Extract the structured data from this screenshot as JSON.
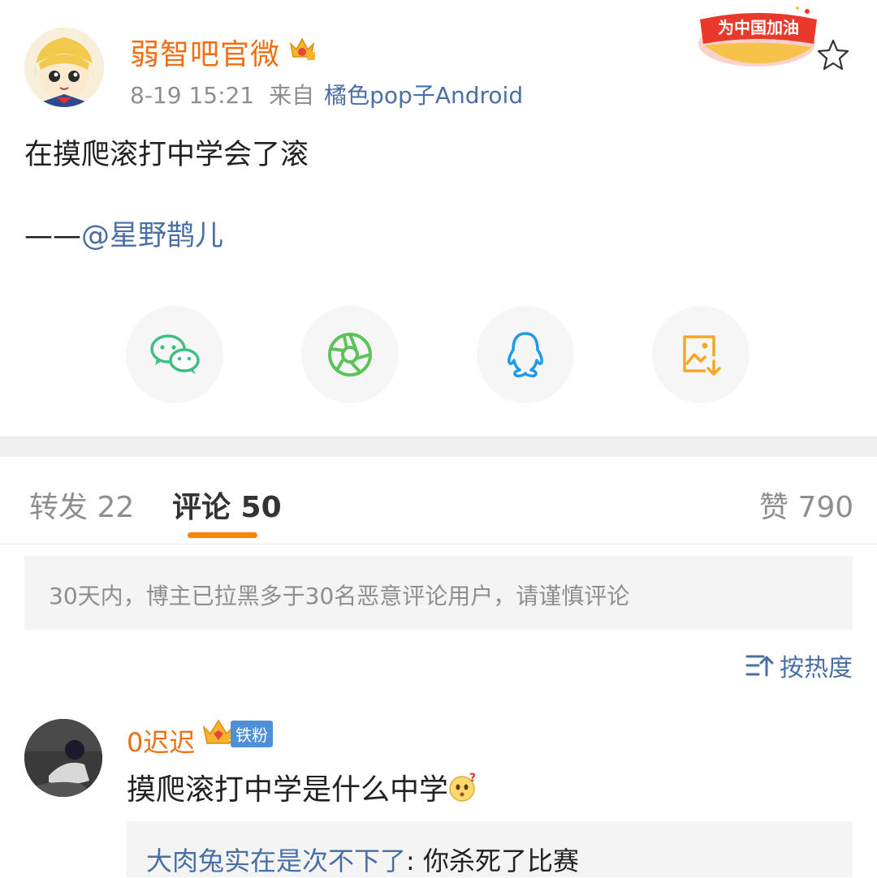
{
  "post": {
    "username": "弱智吧官微",
    "time": "8-19 15:21",
    "from_label": "来自",
    "source": "橘色pop子Android",
    "badge_text": "为中国加油",
    "text": "在摸爬滚打中学会了滚",
    "author_prefix": "——",
    "author_mention": "@星野鹊儿"
  },
  "share": [
    {
      "name": "wechat-icon",
      "color": "#3fbf86"
    },
    {
      "name": "moments-icon",
      "color": "#5cc35a"
    },
    {
      "name": "qq-icon",
      "color": "#1e9be8"
    },
    {
      "name": "save-image-icon",
      "color": "#f5a623"
    }
  ],
  "tabs": {
    "repost": "转发 22",
    "comment": "评论 50",
    "like": "赞 790"
  },
  "notice": "30天内，博主已拉黑多于30名恶意评论用户，请谨慎评论",
  "sort_label": "按热度",
  "comment": {
    "username": "0迟迟",
    "fan_tag": "铁粉",
    "text": "摸爬滚打中学是什么中学",
    "reply_user": "大肉兔实在是次不下了",
    "reply_text": ": 你杀死了比赛"
  },
  "colors": {
    "accent_orange": "#ff8200",
    "username_orange": "#f06f12",
    "link_blue": "#4a6fa5"
  }
}
